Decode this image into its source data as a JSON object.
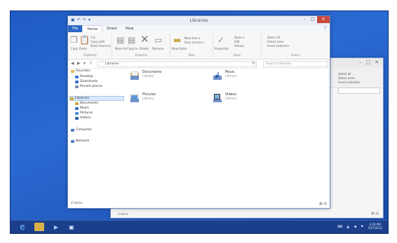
{
  "window": {
    "title": "Libraries",
    "tabs": [
      "File",
      "Home",
      "Share",
      "View"
    ],
    "controls": {
      "minimize": "–",
      "maximize": "□",
      "close": "✕"
    }
  },
  "ribbon": {
    "groups": [
      {
        "name": "Clipboard",
        "items": [
          "Copy",
          "Paste",
          "Cut",
          "Copy path",
          "Paste shortcut"
        ]
      },
      {
        "name": "Organize",
        "items": [
          "Move to",
          "Copy to",
          "Delete",
          "Rename"
        ]
      },
      {
        "name": "New",
        "items": [
          "New folder",
          "New item ▾",
          "Easy access ▾"
        ]
      },
      {
        "name": "Open",
        "items": [
          "Properties",
          "Open ▾",
          "Edit",
          "History"
        ]
      },
      {
        "name": "Select",
        "items": [
          "Select all",
          "Select none",
          "Invert selection"
        ]
      }
    ]
  },
  "address": {
    "path": "Libraries",
    "search_placeholder": "Search Libraries"
  },
  "nav": {
    "favorites": "Favorites",
    "favorites_items": [
      "Desktop",
      "Downloads",
      "Recent places"
    ],
    "libraries": "Libraries",
    "library_items": [
      "Documents",
      "Music",
      "Pictures",
      "Videos"
    ],
    "computer": "Computer",
    "network": "Network"
  },
  "libraries": [
    {
      "name": "Documents",
      "type": "Library"
    },
    {
      "name": "Music",
      "type": "Library"
    },
    {
      "name": "Pictures",
      "type": "Library"
    },
    {
      "name": "Videos",
      "type": "Library"
    }
  ],
  "status": {
    "items_main": "4 items",
    "items_back": "4 items"
  },
  "back_window": {
    "side_items": [
      "Select all",
      "Select none",
      "Invert selection"
    ]
  },
  "taskbar": {
    "clock_time": "4:29 PM",
    "clock_date": "4/27/2012"
  },
  "colors": {
    "desktop": "#1d4fb2",
    "file_tab": "#2b67c6",
    "close_button": "#c74a3c",
    "taskbar": "#1b3f8a"
  }
}
